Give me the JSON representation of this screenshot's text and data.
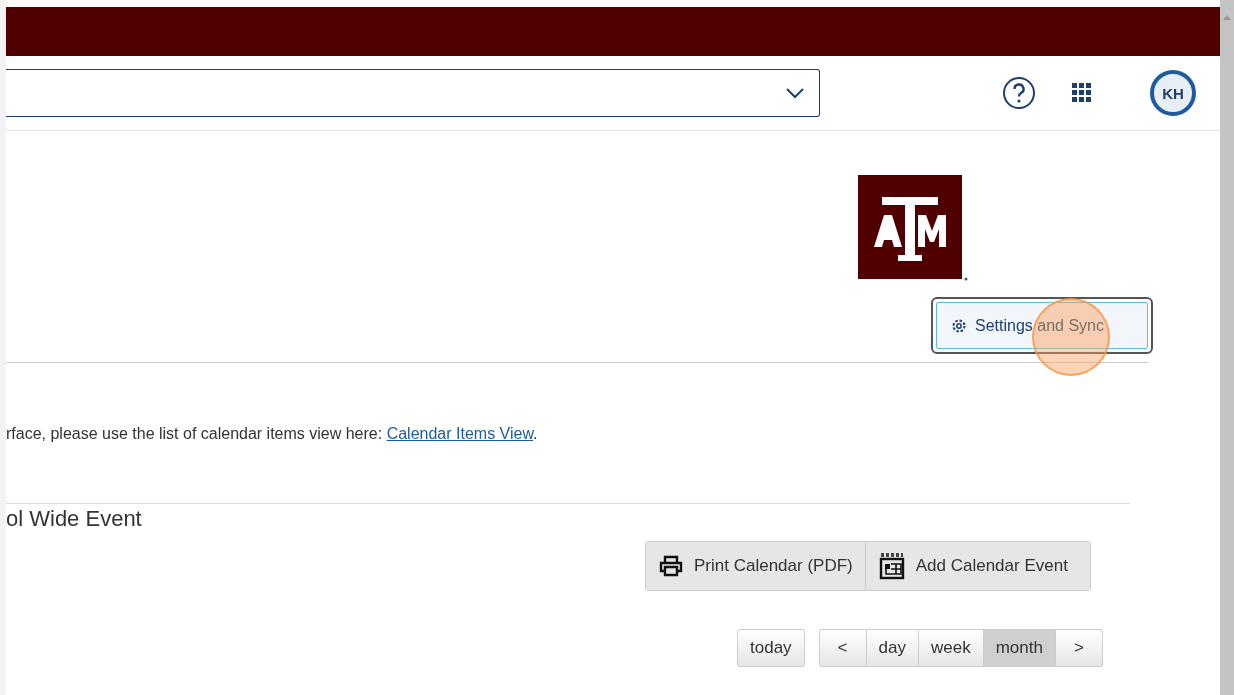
{
  "header": {
    "user_initials": "KH"
  },
  "settings_button": {
    "label": "Settings and Sync",
    "focused": true
  },
  "notice": {
    "text": "rface, please use the list of calendar items view here: ",
    "link": "Calendar Items View",
    "end": "."
  },
  "section_title": "ol Wide Event",
  "actions": [
    {
      "kind": "print",
      "label": "Print Calendar (PDF)"
    },
    {
      "kind": "add",
      "label": "Add Calendar Event"
    }
  ],
  "today_button": "today",
  "nav": [
    {
      "kind": "prev",
      "label": "<"
    },
    {
      "kind": "view",
      "label": "day",
      "selected": false
    },
    {
      "kind": "view",
      "label": "week",
      "selected": false
    },
    {
      "kind": "view",
      "label": "month",
      "selected": true
    },
    {
      "kind": "next",
      "label": ">"
    }
  ]
}
